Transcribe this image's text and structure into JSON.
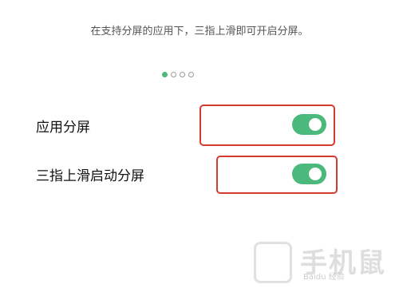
{
  "description": "在支持分屏的应用下，三指上滑即可开启分屏。",
  "pager": {
    "count": 4,
    "active_index": 0
  },
  "settings": [
    {
      "label": "应用分屏",
      "enabled": true
    },
    {
      "label": "三指上滑启动分屏",
      "enabled": true
    }
  ],
  "watermark": {
    "text": "手机鼠",
    "sub": "Baidu 经验"
  },
  "colors": {
    "accent": "#4cb97c",
    "highlight": "#d63a2f"
  }
}
